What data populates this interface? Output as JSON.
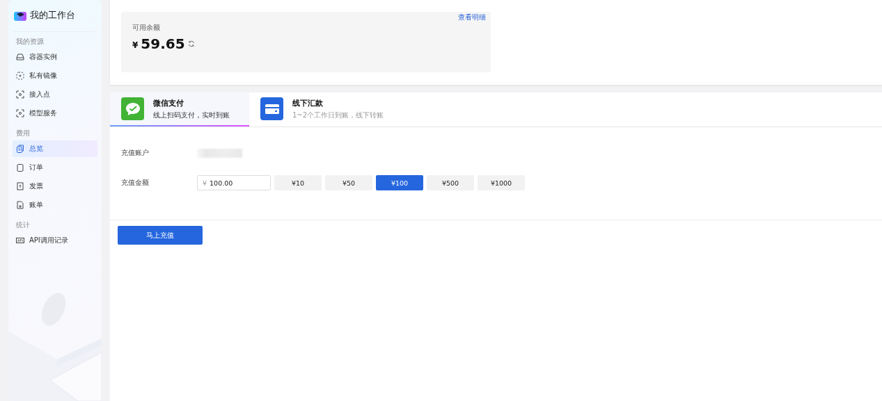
{
  "sidebar": {
    "title": "我的工作台",
    "groups": [
      {
        "heading": "我的资源",
        "items": [
          {
            "label": "容器实例",
            "kind": "drive",
            "selected": false
          },
          {
            "label": "私有镜像",
            "kind": "dashed",
            "selected": false
          },
          {
            "label": "接入点",
            "kind": "scan",
            "selected": false
          },
          {
            "label": "模型服务",
            "kind": "scan",
            "selected": false
          }
        ]
      },
      {
        "heading": "费用",
        "items": [
          {
            "label": "总览",
            "kind": "copy",
            "selected": true
          },
          {
            "label": "订单",
            "kind": "clipboard",
            "selected": false
          },
          {
            "label": "发票",
            "kind": "invoice",
            "selected": false
          },
          {
            "label": "账单",
            "kind": "file",
            "selected": false
          }
        ]
      },
      {
        "heading": "统计",
        "items": [
          {
            "label": "API调用记录",
            "kind": "api",
            "selected": false
          }
        ]
      }
    ]
  },
  "balance": {
    "label": "可用余额",
    "currency": "¥",
    "amount": "59.65",
    "detail_link": "查看明细"
  },
  "pay_tabs": [
    {
      "title": "微信支付",
      "subtitle": "线上扫码支付，实时到账",
      "kind": "wechat",
      "selected": true
    },
    {
      "title": "线下汇款",
      "subtitle": "1~2个工作日到账，线下转账",
      "kind": "card",
      "selected": false
    }
  ],
  "form": {
    "account_label": "充值账户",
    "amount_label": "充值金额",
    "amount_prefix": "¥",
    "amount_value": "100.00",
    "presets": [
      {
        "label": "¥10",
        "selected": false
      },
      {
        "label": "¥50",
        "selected": false
      },
      {
        "label": "¥100",
        "selected": true
      },
      {
        "label": "¥500",
        "selected": false
      },
      {
        "label": "¥1000",
        "selected": false
      }
    ]
  },
  "submit": "马上充值"
}
